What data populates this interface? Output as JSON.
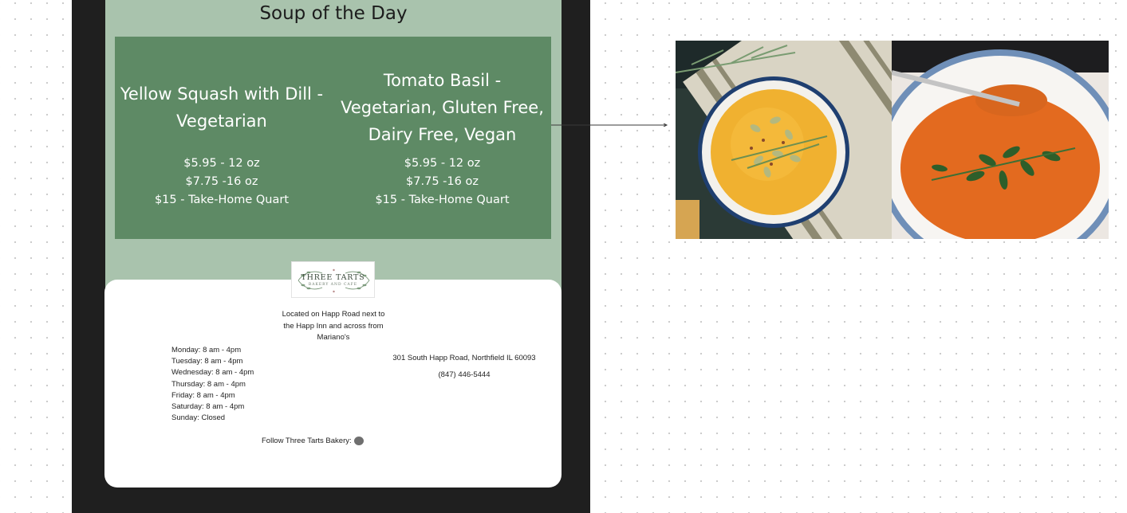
{
  "menu": {
    "heading": "Soup of the Day",
    "soups": [
      {
        "name": "Yellow Squash with Dill - Vegetarian",
        "prices": [
          "$5.95 - 12 oz",
          "$7.75 -16 oz",
          "$15 - Take-Home Quart"
        ]
      },
      {
        "name": "Tomato Basil - Vegetarian, Gluten Free, Dairy Free, Vegan",
        "prices": [
          "$5.95 - 12 oz",
          "$7.75 -16 oz",
          "$15 - Take-Home Quart"
        ]
      }
    ]
  },
  "footer": {
    "logo": {
      "title": "THREE TARTS",
      "subtitle": "BAKERY AND CAFE"
    },
    "location": "Located on Happ Road next to the Happ Inn and across from Mariano's",
    "hours": [
      "Monday: 8 am - 4pm",
      "Tuesday: 8 am - 4pm",
      "Wednesday: 8 am - 4pm",
      "Thursday: 8 am - 4pm",
      "Friday: 8 am - 4pm",
      "Saturday: 8 am - 4pm",
      "Sunday: Closed"
    ],
    "address": "301 South Happ Road, Northfield IL 60093",
    "phone": "(847) 446-5444",
    "follow_label": "Follow Three Tarts Bakery:",
    "social_icon": "instagram-icon"
  },
  "photos": [
    {
      "subject": "yellow-squash-soup-photo"
    },
    {
      "subject": "tomato-basil-soup-photo"
    }
  ],
  "colors": {
    "device_frame": "#1f1f1f",
    "sage_background": "#a9c3ad",
    "panel_green": "#5e8a65"
  }
}
